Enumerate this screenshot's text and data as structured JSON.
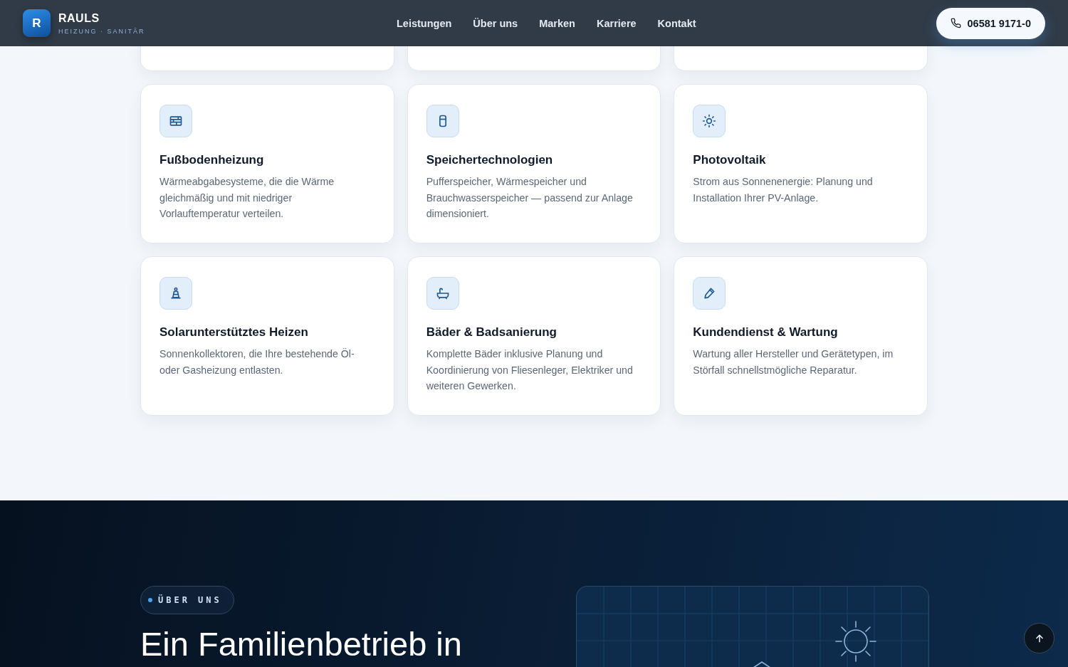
{
  "header": {
    "logo_letter": "R",
    "brand": "RAULS",
    "tagline": "HEIZUNG · SANITÄR",
    "nav": [
      {
        "label": "Leistungen"
      },
      {
        "label": "Über uns"
      },
      {
        "label": "Marken"
      },
      {
        "label": "Karriere"
      },
      {
        "label": "Kontakt"
      }
    ],
    "phone": "06581 9171-0"
  },
  "services": {
    "cards": [
      {
        "kind": "cut"
      },
      {
        "kind": "cut"
      },
      {
        "kind": "cut"
      },
      {
        "kind": "service",
        "title": "Fußbodenheizung",
        "text": "Wärmeabgabesysteme, die die Wärme gleichmäßig und mit niedriger Vorlauftemperatur verteilen."
      },
      {
        "kind": "service",
        "title": "Speichertechnologien",
        "text": "Pufferspeicher, Wärmespeicher und Brauchwasserspeicher — passend zur Anlage dimensioniert."
      },
      {
        "kind": "service",
        "title": "Photovoltaik",
        "text": "Strom aus Sonnenenergie: Planung und Installation Ihrer PV-Anlage."
      },
      {
        "kind": "service",
        "title": "Solarunterstütztes Heizen",
        "text": "Sonnenkollektoren, die Ihre bestehende Öl- oder Gasheizung entlasten."
      },
      {
        "kind": "service",
        "title": "Bäder & Badsanierung",
        "text": "Komplette Bäder inklusive Planung und Koordinierung von Fliesenleger, Elektriker und weiteren Gewerken."
      },
      {
        "kind": "service",
        "title": "Kundendienst & Wartung",
        "text": "Wartung aller Hersteller und Gerätetypen, im Störfall schnellstmögliche Reparatur."
      }
    ]
  },
  "about": {
    "badge": "ÜBER UNS",
    "heading": "Ein Familienbetrieb in"
  }
}
